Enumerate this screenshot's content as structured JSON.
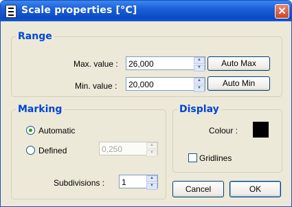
{
  "window": {
    "title": "Scale properties [°C]",
    "close_symbol": "✕"
  },
  "range": {
    "legend": "Range",
    "max_label": "Max. value :",
    "max_value": "26,000",
    "auto_max_label": "Auto Max",
    "min_label": "Min. value :",
    "min_value": "20,000",
    "auto_min_label": "Auto Min"
  },
  "marking": {
    "legend": "Marking",
    "automatic_label": "Automatic",
    "defined_label": "Defined",
    "defined_value": "0,250",
    "subdivisions_label": "Subdivisions :",
    "subdivisions_value": "1",
    "selected": "Automatic"
  },
  "display": {
    "legend": "Display",
    "colour_label": "Colour :",
    "colour_value": "#000000",
    "gridlines_label": "Gridlines",
    "gridlines_checked": false
  },
  "buttons": {
    "cancel": "Cancel",
    "ok": "OK"
  }
}
